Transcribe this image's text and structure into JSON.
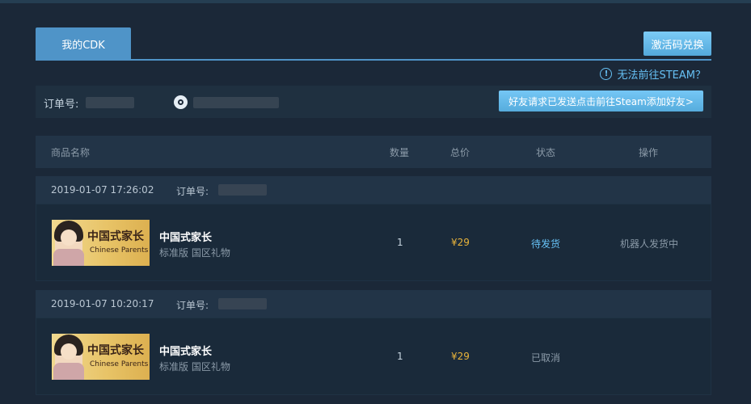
{
  "tabs": {
    "active_label": "我的CDK"
  },
  "header": {
    "redeem_button": "激活码兑换",
    "cant_steam_icon_text": "!",
    "cant_steam_link": "无法前往STEAM？"
  },
  "order_info": {
    "order_label": "订单号:",
    "steam_icon": "steam-icon",
    "friend_button": "好友请求已发送点击前往Steam添加好友>"
  },
  "table": {
    "headers": [
      "商品名称",
      "数量",
      "总价",
      "状态",
      "操作"
    ]
  },
  "orders": [
    {
      "datetime": "2019-01-07 17:26:02",
      "order_label": "订单号:",
      "cover_cn": "中国式家长",
      "cover_en": "Chinese Parents",
      "name": "中国式家长",
      "subtitle": "标准版 国区礼物",
      "quantity": "1",
      "price": "¥29",
      "status": "待发货",
      "status_color": "#66c0f4",
      "operation": "机器人发货中"
    },
    {
      "datetime": "2019-01-07 10:20:17",
      "order_label": "订单号:",
      "cover_cn": "中国式家长",
      "cover_en": "Chinese Parents",
      "name": "中国式家长",
      "subtitle": "标准版 国区礼物",
      "quantity": "1",
      "price": "¥29",
      "status": "已取消",
      "status_color": "#8b9aa8",
      "operation": ""
    }
  ]
}
